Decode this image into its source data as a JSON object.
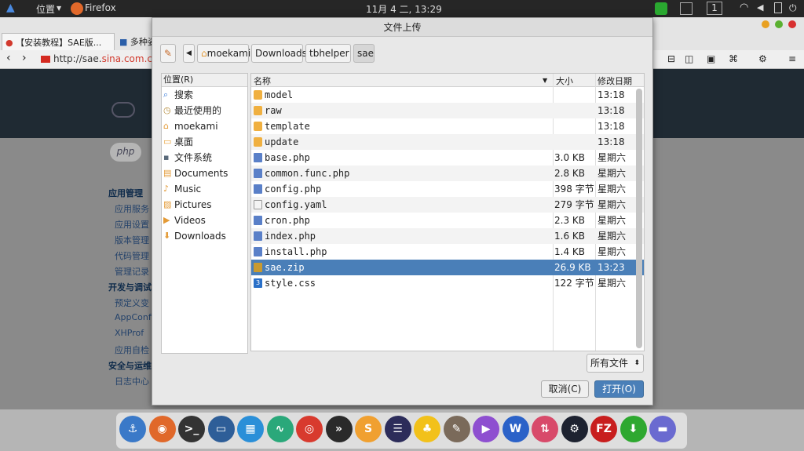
{
  "topbar": {
    "places_menu": "位置",
    "app_name": "Firefox",
    "clock": "11月 4 二, 13:29",
    "workspace": "1"
  },
  "browser": {
    "tabs": [
      "【安装教程】SAE版...",
      "多种姿"
    ],
    "url_prefix": "http://sae.",
    "url_link": "sina.com.cn/",
    "sidebar": {
      "section1": "应用管理",
      "section1_items": [
        "应用服务",
        "应用设置",
        "版本管理",
        "代码管理",
        "管理记录"
      ],
      "section2": "开发与调试",
      "section2_items": [
        "预定义变",
        "AppConfi",
        "XHProf",
        "应用自检"
      ],
      "section3": "安全与运维",
      "section3_items": [
        "日志中心"
      ]
    }
  },
  "dialog": {
    "title": "文件上传",
    "path": [
      "moekami",
      "Downloads",
      "tbhelper",
      "sae"
    ],
    "places_header": "位置(R)",
    "places": [
      {
        "label": "搜索",
        "icon": "search-icon",
        "color": "#3b7dd8"
      },
      {
        "label": "最近使用的",
        "icon": "recent-icon",
        "color": "#b58b3a"
      },
      {
        "label": "moekami",
        "icon": "home-folder-icon",
        "color": "#e39a36"
      },
      {
        "label": "桌面",
        "icon": "desktop-icon",
        "color": "#e8a23a"
      },
      {
        "label": "文件系统",
        "icon": "drive-icon",
        "color": "#5a6a7a"
      },
      {
        "label": "Documents",
        "icon": "documents-icon",
        "color": "#e39a36"
      },
      {
        "label": "Music",
        "icon": "music-icon",
        "color": "#e39a36"
      },
      {
        "label": "Pictures",
        "icon": "pictures-icon",
        "color": "#e39a36"
      },
      {
        "label": "Videos",
        "icon": "videos-icon",
        "color": "#e39a36"
      },
      {
        "label": "Downloads",
        "icon": "downloads-icon",
        "color": "#e39a36"
      }
    ],
    "columns": {
      "name": "名称",
      "size": "大小",
      "modified": "修改日期"
    },
    "files": [
      {
        "name": "model",
        "size": "",
        "modified": "13:18",
        "type": "folder",
        "selected": false
      },
      {
        "name": "raw",
        "size": "",
        "modified": "13:18",
        "type": "folder",
        "selected": false
      },
      {
        "name": "template",
        "size": "",
        "modified": "13:18",
        "type": "folder",
        "selected": false
      },
      {
        "name": "update",
        "size": "",
        "modified": "13:18",
        "type": "folder",
        "selected": false
      },
      {
        "name": "base.php",
        "size": "3.0 KB",
        "modified": "星期六",
        "type": "php",
        "selected": false
      },
      {
        "name": "common.func.php",
        "size": "2.8 KB",
        "modified": "星期六",
        "type": "php",
        "selected": false
      },
      {
        "name": "config.php",
        "size": "398 字节",
        "modified": "星期六",
        "type": "php",
        "selected": false
      },
      {
        "name": "config.yaml",
        "size": "279 字节",
        "modified": "星期六",
        "type": "text",
        "selected": false
      },
      {
        "name": "cron.php",
        "size": "2.3 KB",
        "modified": "星期六",
        "type": "php",
        "selected": false
      },
      {
        "name": "index.php",
        "size": "1.6 KB",
        "modified": "星期六",
        "type": "php",
        "selected": false
      },
      {
        "name": "install.php",
        "size": "1.4 KB",
        "modified": "星期六",
        "type": "php",
        "selected": false
      },
      {
        "name": "sae.zip",
        "size": "26.9 KB",
        "modified": "13:23",
        "type": "zip",
        "selected": true
      },
      {
        "name": "style.css",
        "size": "122 字节",
        "modified": "星期六",
        "type": "css",
        "selected": false
      }
    ],
    "filter": "所有文件",
    "cancel_label": "取消(C)",
    "open_label": "打开(O)"
  },
  "dock": [
    {
      "icon": "anchor-icon",
      "color": "#3a79c8",
      "glyph": "⚓"
    },
    {
      "icon": "firefox-icon",
      "color": "#e0682a",
      "glyph": "◉"
    },
    {
      "icon": "terminal-icon",
      "color": "#333333",
      "glyph": ">_"
    },
    {
      "icon": "files-icon",
      "color": "#2e5e98",
      "glyph": "▭"
    },
    {
      "icon": "system-monitor-icon",
      "color": "#2a8fd8",
      "glyph": "▦"
    },
    {
      "icon": "pulse-icon",
      "color": "#2aa87a",
      "glyph": "∿"
    },
    {
      "icon": "chrome-icon",
      "color": "#d83a2e",
      "glyph": "◎"
    },
    {
      "icon": "play-forward-icon",
      "color": "#2a2a2a",
      "glyph": "»"
    },
    {
      "icon": "sublime-icon",
      "color": "#f0a030",
      "glyph": "S"
    },
    {
      "icon": "eclipse-icon",
      "color": "#2c2c5a",
      "glyph": "☰"
    },
    {
      "icon": "qq-icon",
      "color": "#f2c11a",
      "glyph": "♣"
    },
    {
      "icon": "gimp-icon",
      "color": "#7a6a5a",
      "glyph": "✎"
    },
    {
      "icon": "media-player-icon",
      "color": "#8e4fd0",
      "glyph": "▶"
    },
    {
      "icon": "wps-writer-icon",
      "color": "#2b62c8",
      "glyph": "W"
    },
    {
      "icon": "transfer-icon",
      "color": "#d84a6a",
      "glyph": "⇅"
    },
    {
      "icon": "steam-icon",
      "color": "#1d2230",
      "glyph": "⚙"
    },
    {
      "icon": "filezilla-icon",
      "color": "#c81e1e",
      "glyph": "FZ"
    },
    {
      "icon": "download-manager-icon",
      "color": "#2ea830",
      "glyph": "⬇"
    },
    {
      "icon": "folder-icon",
      "color": "#6a6ad0",
      "glyph": "▬"
    }
  ]
}
